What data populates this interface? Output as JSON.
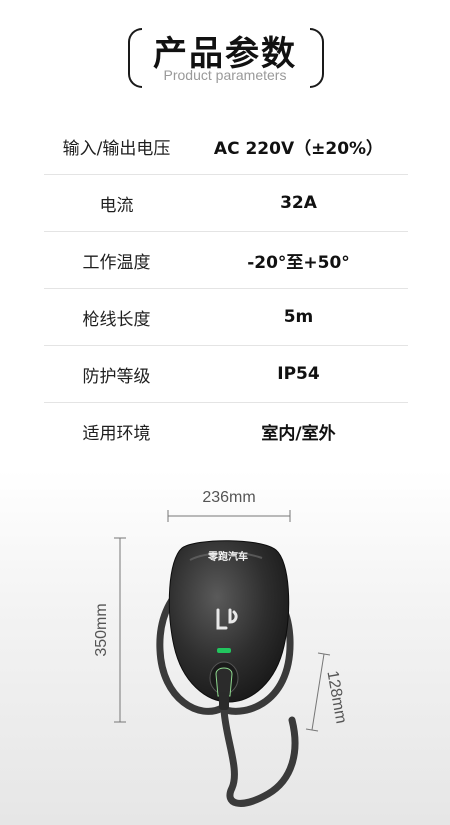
{
  "header": {
    "title": "产品参数",
    "subtitle": "Product parameters"
  },
  "specs": [
    {
      "label": "输入/输出电压",
      "value": "AC 220V（±20%）"
    },
    {
      "label": "电流",
      "value": "32A"
    },
    {
      "label": "工作温度",
      "value": "-20°至+50°"
    },
    {
      "label": "枪线长度",
      "value": "5m"
    },
    {
      "label": "防护等级",
      "value": "IP54"
    },
    {
      "label": "适用环境",
      "value": "室内/室外"
    }
  ],
  "dimensions": {
    "width": "236mm",
    "height": "350mm",
    "depth": "128mm"
  },
  "product": {
    "brand_text": "零跑汽车",
    "logo_icon": "leapmotor-logo-icon",
    "indicator_color": "#22c55e"
  }
}
